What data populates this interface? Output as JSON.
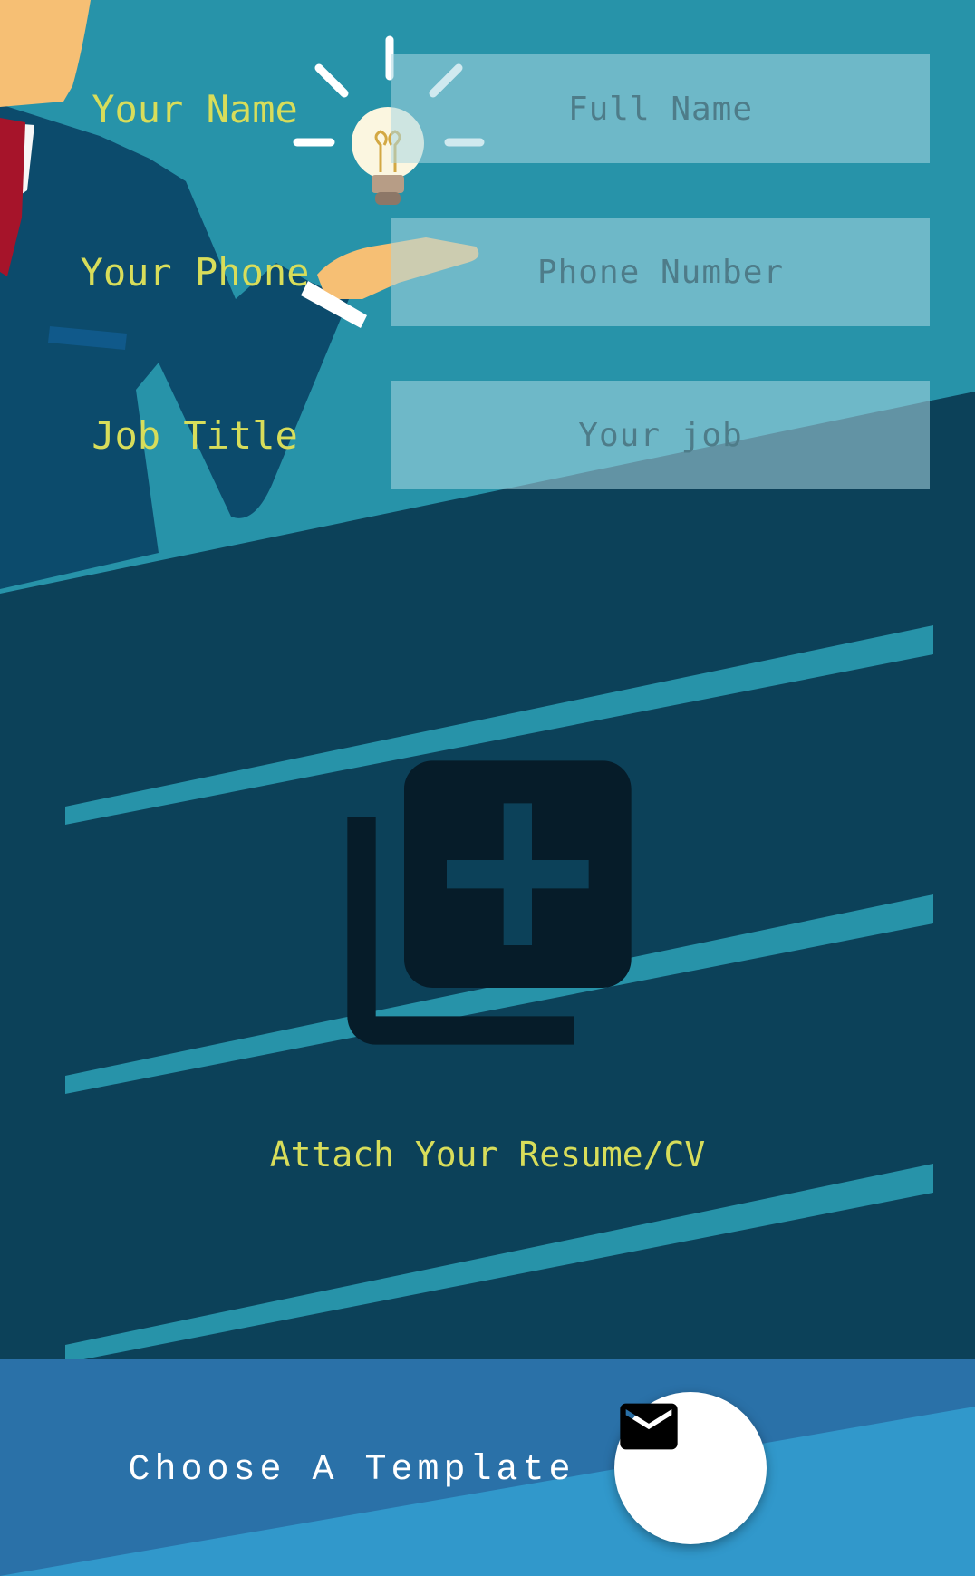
{
  "form": {
    "fields": [
      {
        "label": "Your Name",
        "placeholder": "Full Name"
      },
      {
        "label": "Your Phone",
        "placeholder": "Phone Number"
      },
      {
        "label": "Job Title",
        "placeholder": "Your job"
      }
    ]
  },
  "attach": {
    "label": "Attach Your Resume/CV",
    "icon": "library-add-icon"
  },
  "bottom_bar": {
    "template_label": "Choose A Template",
    "fab_icon": "mail-icon"
  },
  "colors": {
    "background_dark": "#0c4159",
    "background_teal": "#2793a9",
    "label_yellow": "#d8dd5a",
    "bottom_bar_blue": "#2a71a8",
    "bottom_bar_light": "#3198cb"
  }
}
